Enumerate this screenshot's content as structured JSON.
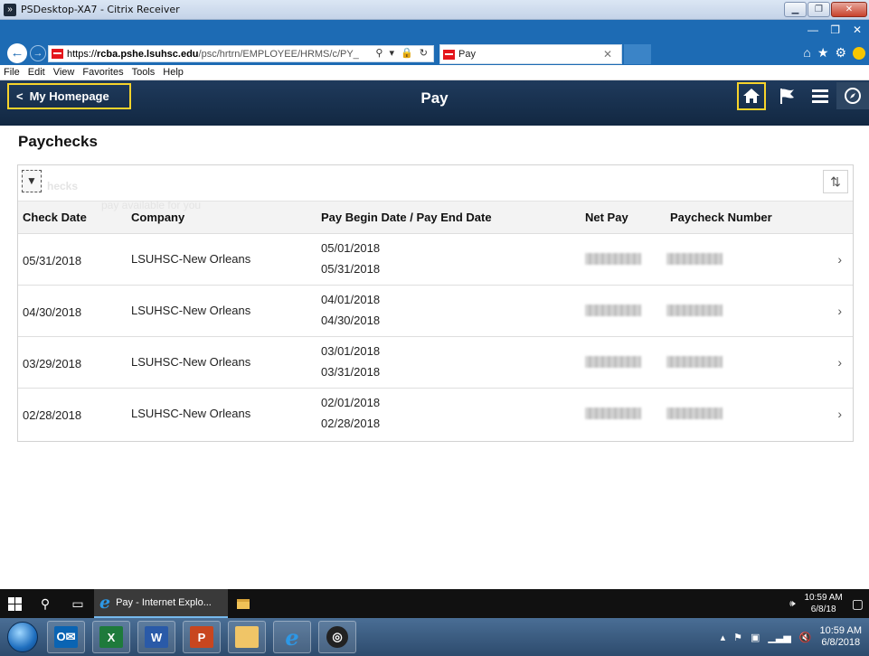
{
  "citrix": {
    "title": "PSDesktop-XA7 - Citrix Receiver"
  },
  "browser": {
    "url_prefix": "https://",
    "url_host": "rcba.pshe.lsuhsc.edu",
    "url_path": "/psc/hrtrn/EMPLOYEE/HRMS/c/PY_",
    "tab_title": "Pay",
    "menu": [
      "File",
      "Edit",
      "View",
      "Favorites",
      "Tools",
      "Help"
    ]
  },
  "banner": {
    "home_link": "My Homepage",
    "title": "Pay"
  },
  "page": {
    "heading": "Paychecks",
    "ghost_title": "hecks",
    "ghost_text": "pay                  available for you"
  },
  "grid": {
    "columns": [
      "Check Date",
      "Company",
      "Pay Begin Date / Pay End Date",
      "Net Pay",
      "Paycheck Number"
    ],
    "rows": [
      {
        "check_date": "05/31/2018",
        "company": "LSUHSC-New Orleans",
        "begin": "05/01/2018",
        "end": "05/31/2018"
      },
      {
        "check_date": "04/30/2018",
        "company": "LSUHSC-New Orleans",
        "begin": "04/01/2018",
        "end": "04/30/2018"
      },
      {
        "check_date": "03/29/2018",
        "company": "LSUHSC-New Orleans",
        "begin": "03/01/2018",
        "end": "03/31/2018"
      },
      {
        "check_date": "02/28/2018",
        "company": "LSUHSC-New Orleans",
        "begin": "02/01/2018",
        "end": "02/28/2018"
      }
    ]
  },
  "taskbar": {
    "ie_label": "Pay - Internet Explo...",
    "time": "10:59 AM",
    "date": "6/8/18",
    "time2": "10:59 AM",
    "date2": "6/8/2018"
  }
}
